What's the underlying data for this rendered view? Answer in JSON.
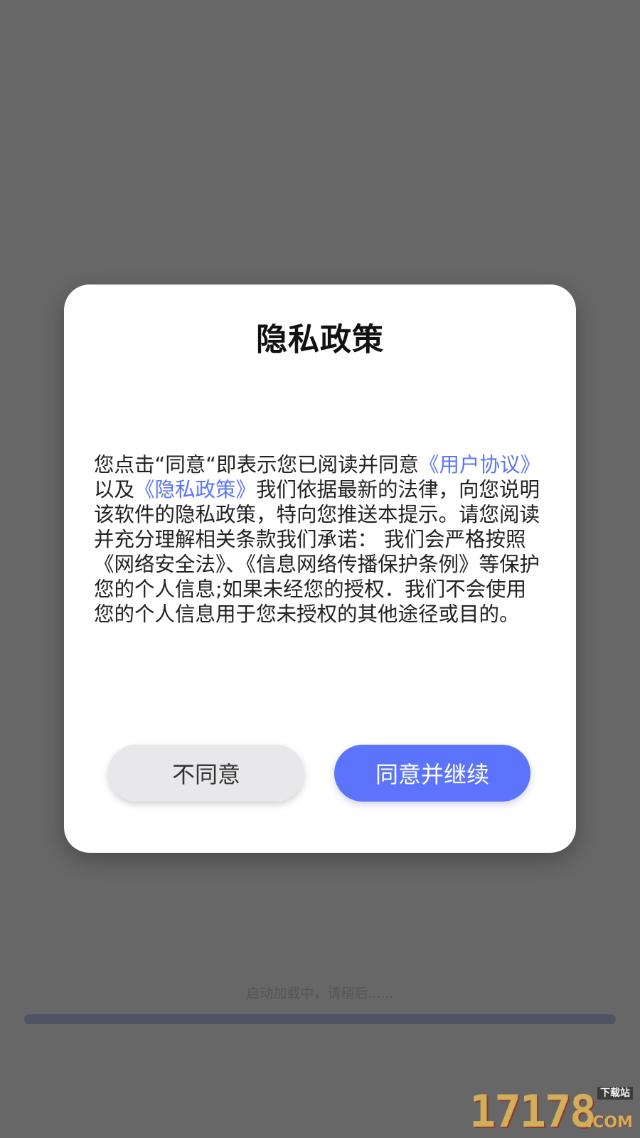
{
  "dialog": {
    "title": "隐私政策",
    "body": {
      "part1": "您点击“同意“即表示您已阅读并同意",
      "link_user_agreement": "《用户协议》",
      "part2": "以及",
      "link_privacy_policy": "《隐私政策》",
      "part3": "我们依据最新的法律，向您说明该软件的隐私政策，特向您推送本提示。请您阅读并充分理解相关条款我们承诺： 我们会严格按照《网络安全法》、《信息网络传播保护条例》等保护您的个人信息;如果未经您的授权．我们不会使用您的个人信息用于您未授权的其他途径或目的。"
    },
    "buttons": {
      "disagree": "不同意",
      "agree": "同意并继续"
    }
  },
  "loading": {
    "text": "启动加载中，请稍后......",
    "progress": 0.0
  },
  "watermark": {
    "digits": "17178",
    "top_label": "下载站",
    "suffix": ".COM"
  },
  "colors": {
    "overlay_bg": "#676767",
    "link": "#5a76f7",
    "agree_button": "#5b74fb",
    "disagree_button": "#e8e8ea",
    "progress_track": "#4e5464"
  }
}
